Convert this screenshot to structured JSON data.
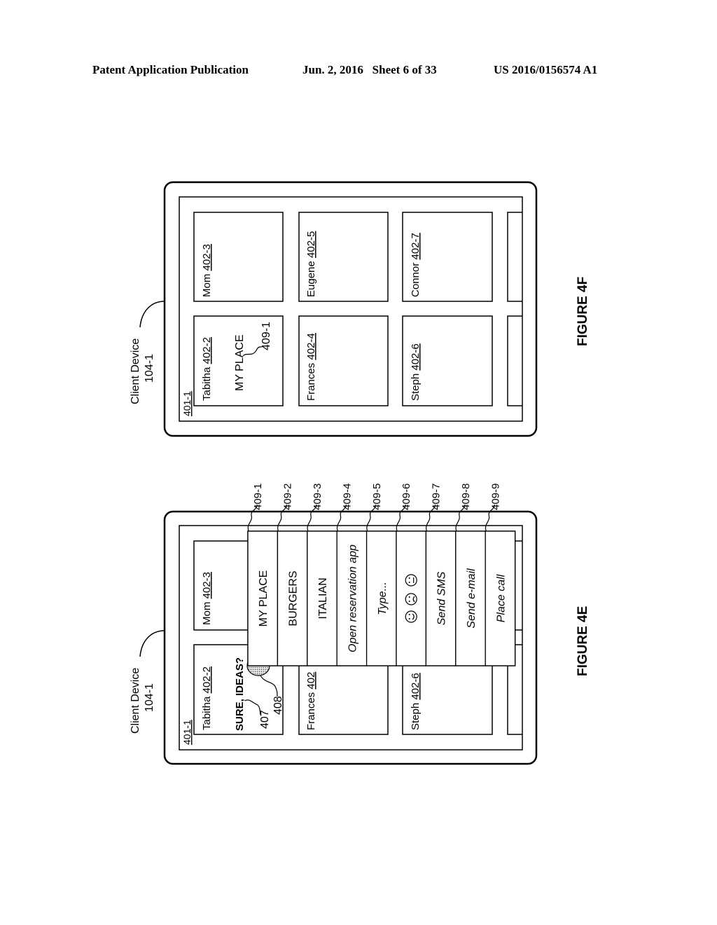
{
  "header": {
    "publication": "Patent Application Publication",
    "date_sheet": "Jun. 2, 2016   Sheet 6 of 33",
    "patent_number": "US 2016/0156574 A1"
  },
  "figure_4f": {
    "caption": "FIGURE 4F",
    "device_label": "Client Device",
    "device_ref": "104-1",
    "screen_ref": "401-1",
    "tiles": [
      {
        "name": "Tabitha",
        "ref": "402-2",
        "content": "MY PLACE",
        "content_ref": "409-1"
      },
      {
        "name": "Mom",
        "ref": "402-3"
      },
      {
        "name": "Frances",
        "ref": "402-4"
      },
      {
        "name": "Eugene",
        "ref": "402-5"
      },
      {
        "name": "Steph",
        "ref": "402-6"
      },
      {
        "name": "Connor",
        "ref": "402-7"
      }
    ]
  },
  "figure_4e": {
    "caption": "FIGURE 4E",
    "device_label": "Client Device",
    "device_ref": "104-1",
    "screen_ref": "401-1",
    "tiles": [
      {
        "name": "Tabitha",
        "ref": "402-2",
        "message": "SURE, IDEAS?",
        "message_ref": "407",
        "touch_ref": "408"
      },
      {
        "name": "Mom",
        "ref": "402-3"
      },
      {
        "name": "Frances",
        "ref": "402"
      },
      {
        "name": "Steph",
        "ref": "402-6"
      }
    ],
    "menu_options": [
      {
        "label": "MY PLACE",
        "ref": "409-1",
        "italic": false
      },
      {
        "label": "BURGERS",
        "ref": "409-2",
        "italic": false
      },
      {
        "label": "ITALIAN",
        "ref": "409-3",
        "italic": false
      },
      {
        "label": "Open reservation app",
        "ref": "409-4",
        "italic": true
      },
      {
        "label": "Type...",
        "ref": "409-5",
        "italic": true
      },
      {
        "label": "emoji",
        "ref": "409-6",
        "italic": false,
        "icons": [
          "smile-icon",
          "frown-icon",
          "neutral-face-icon"
        ]
      },
      {
        "label": "Send SMS",
        "ref": "409-7",
        "italic": true
      },
      {
        "label": "Send e-mail",
        "ref": "409-8",
        "italic": true
      },
      {
        "label": "Place call",
        "ref": "409-9",
        "italic": true
      }
    ]
  }
}
